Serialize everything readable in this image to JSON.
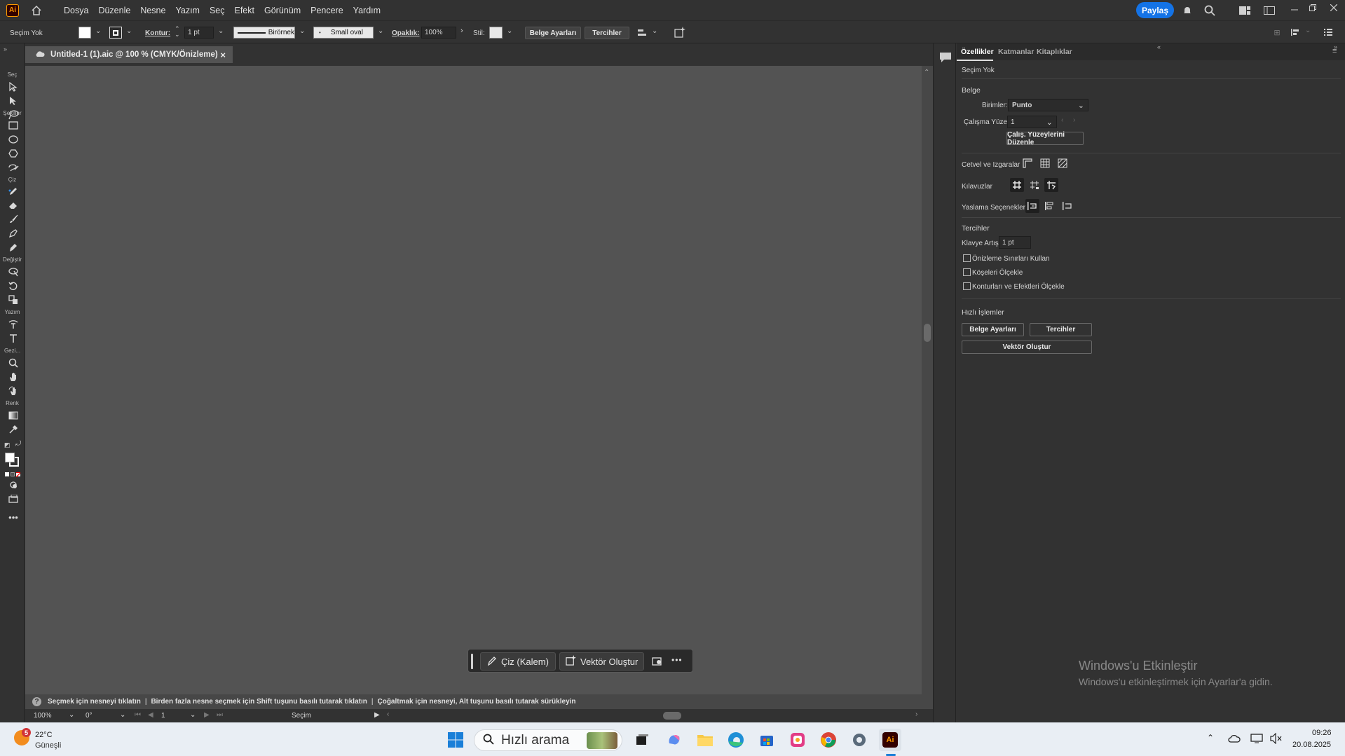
{
  "app": {
    "logo": "Ai",
    "menu": [
      "Dosya",
      "Düzenle",
      "Nesne",
      "Yazım",
      "Seç",
      "Efekt",
      "Görünüm",
      "Pencere",
      "Yardım"
    ],
    "share_label": "Paylaş"
  },
  "control_bar": {
    "selection": "Seçim Yok",
    "stroke_label": "Kontur:",
    "stroke_value": "1 pt",
    "stroke_profile": "Birörnek",
    "brush": "Small oval",
    "opacity_label": "Opaklık:",
    "opacity_value": "100%",
    "style_label": "Stil:",
    "doc_settings_btn": "Belge Ayarları",
    "prefs_btn": "Tercihler"
  },
  "document_tab": {
    "title": "Untitled-1 (1).aic @ 100 % (CMYK/Önizleme)",
    "close": "×"
  },
  "tools": {
    "categories": [
      "Seç",
      "Şekiller",
      "Çiz",
      "Değiştir",
      "Yazım",
      "Gezi...",
      "Renk"
    ]
  },
  "status": {
    "message_parts": [
      "Seçmek için nesneyi tıklatın",
      "Birden fazla nesne seçmek için Shift tuşunu basılı tutarak tıklatın",
      "Çoğaltmak için nesneyi, Alt tuşunu basılı tutarak sürükleyin"
    ],
    "zoom": "100%",
    "rotation": "0°",
    "artboard": "1",
    "tool_name": "Seçim"
  },
  "context_bar": {
    "draw_btn": "Çiz (Kalem)",
    "vector_btn": "Vektör Oluştur",
    "more": "•••"
  },
  "right_panel": {
    "tabs": [
      "Özellikler",
      "Katmanlar",
      "Kitaplıklar"
    ],
    "selection": "Seçim Yok",
    "document_header": "Belge",
    "units_label": "Birimler:",
    "units_value": "Punto",
    "artboard_label": "Çalışma Yüzeyi:",
    "artboard_value": "1",
    "edit_artboards_btn": "Çalış. Yüzeylerini Düzenle",
    "rulers_label": "Cetvel ve Izgaralar",
    "guides_label": "Kılavuzlar",
    "snap_label": "Yaslama Seçenekleri",
    "prefs_header": "Tercihler",
    "keyboard_inc_label": "Klavye Artışı:",
    "keyboard_inc_value": "1 pt",
    "checkboxes": [
      "Önizleme Sınırları Kullan",
      "Köşeleri Ölçekle",
      "Konturları ve Efektleri Ölçekle"
    ],
    "quick_actions_header": "Hızlı İşlemler",
    "doc_settings_btn": "Belge Ayarları",
    "prefs_btn": "Tercihler",
    "vectorize_btn": "Vektör Oluştur"
  },
  "watermark": {
    "line1": "Windows'u Etkinleştir",
    "line2": "Windows'u etkinleştirmek için Ayarlar'a gidin."
  },
  "taskbar": {
    "weather_badge": "5",
    "temp": "22°C",
    "weather_desc": "Güneşli",
    "search_placeholder": "Hızlı arama",
    "time": "09:26",
    "date": "20.08.2025"
  }
}
